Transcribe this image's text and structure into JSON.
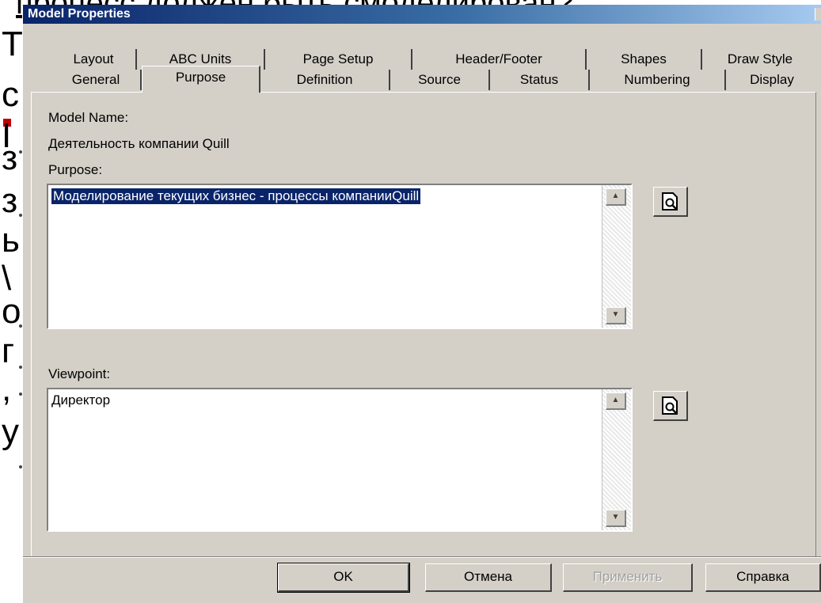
{
  "background": {
    "title_fragment": "процесс должен быть смоделирован?",
    "left_fragments": [
      "Т",
      "с",
      "І",
      "з",
      "з",
      "ь",
      "\\",
      "о",
      "г",
      ",",
      "у"
    ]
  },
  "dialog": {
    "title": "Model Properties",
    "tabs_back": [
      "Layout",
      "ABC Units",
      "Page Setup",
      "Header/Footer",
      "Shapes",
      "Draw Style"
    ],
    "tabs_front": [
      "General",
      "Purpose",
      "Definition",
      "Source",
      "Status",
      "Numbering",
      "Display"
    ],
    "active_tab": "Purpose",
    "model_name_label": "Model Name:",
    "model_name_value": "Деятельность компании Quill",
    "purpose_label": "Purpose:",
    "purpose_value": "Моделирование текущих бизнес - процессы компанииQuill",
    "viewpoint_label": "Viewpoint:",
    "viewpoint_value": "Директор",
    "buttons": {
      "ok": "OK",
      "cancel": "Отмена",
      "apply": "Применить",
      "help": "Справка"
    }
  },
  "colors": {
    "title_bar": "#0a246a",
    "dialog_face": "#d4d0c8",
    "selection": "#0a246a"
  }
}
